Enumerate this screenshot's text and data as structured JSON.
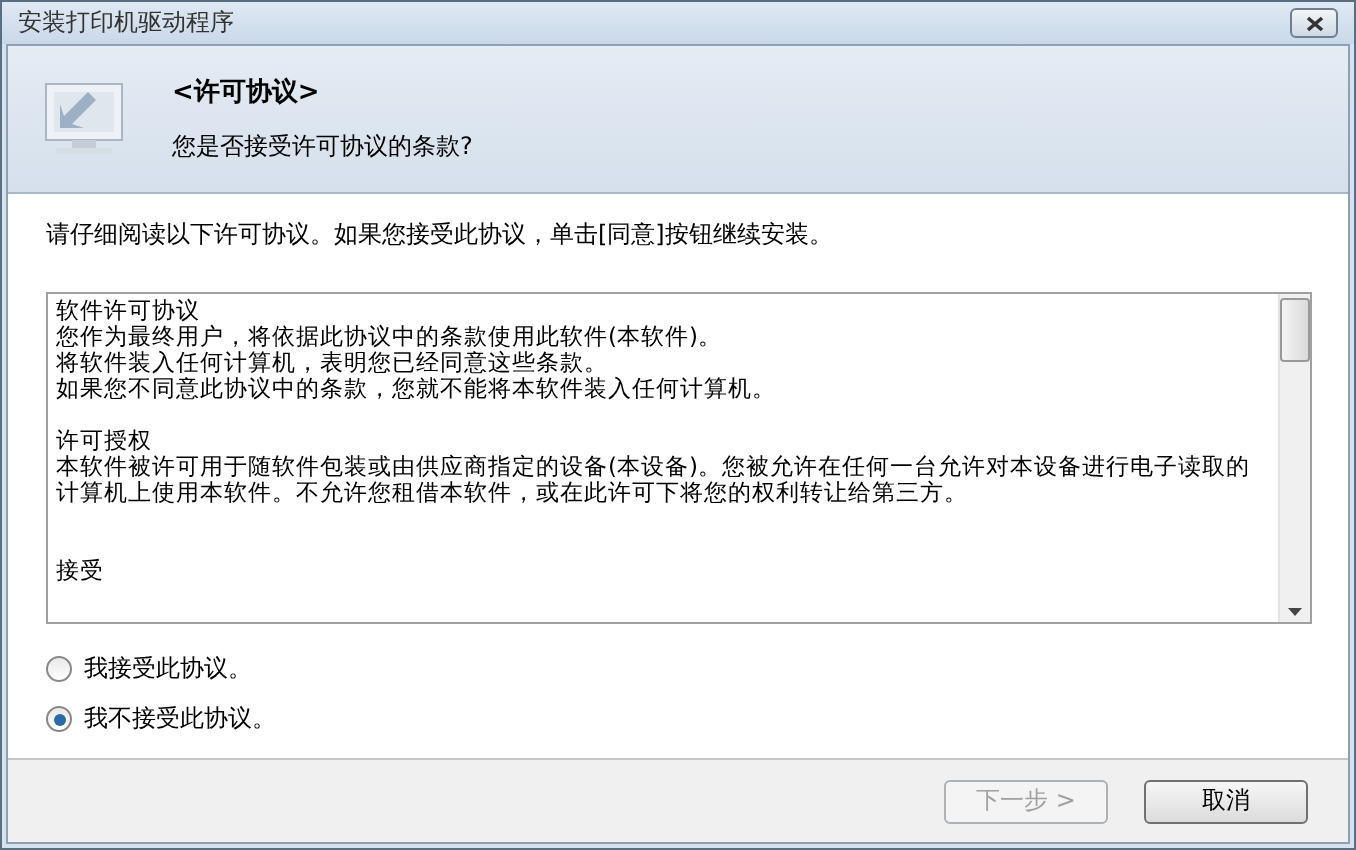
{
  "window": {
    "title": "安装打印机驱动程序"
  },
  "header": {
    "title": "<许可协议>",
    "subtitle": "您是否接受许可协议的条款?"
  },
  "instruction": "请仔细阅读以下许可协议。如果您接受此协议，单击[同意]按钮继续安装。",
  "license": {
    "paragraphs": [
      {
        "lines": [
          "软件许可协议",
          "您作为最终用户，将依据此协议中的条款使用此软件(本软件)。",
          "将软件装入任何计算机，表明您已经同意这些条款。",
          "如果您不同意此协议中的条款，您就不能将本软件装入任何计算机。"
        ]
      },
      {
        "lines": [
          "许可授权",
          "本软件被许可用于随软件包装或由供应商指定的设备(本设备)。您被允许在任何一台允许对本设备进行电子读取的",
          "计算机上使用本软件。不允许您租借本软件，或在此许可下将您的权利转让给第三方。"
        ]
      },
      {
        "lines": [
          "接受"
        ]
      }
    ]
  },
  "options": [
    {
      "label": "我接受此协议。",
      "selected": false
    },
    {
      "label": "我不接受此协议。",
      "selected": true
    }
  ],
  "buttons": [
    {
      "label": "下一步 >",
      "disabled": true
    },
    {
      "label": "取消",
      "disabled": false
    }
  ]
}
